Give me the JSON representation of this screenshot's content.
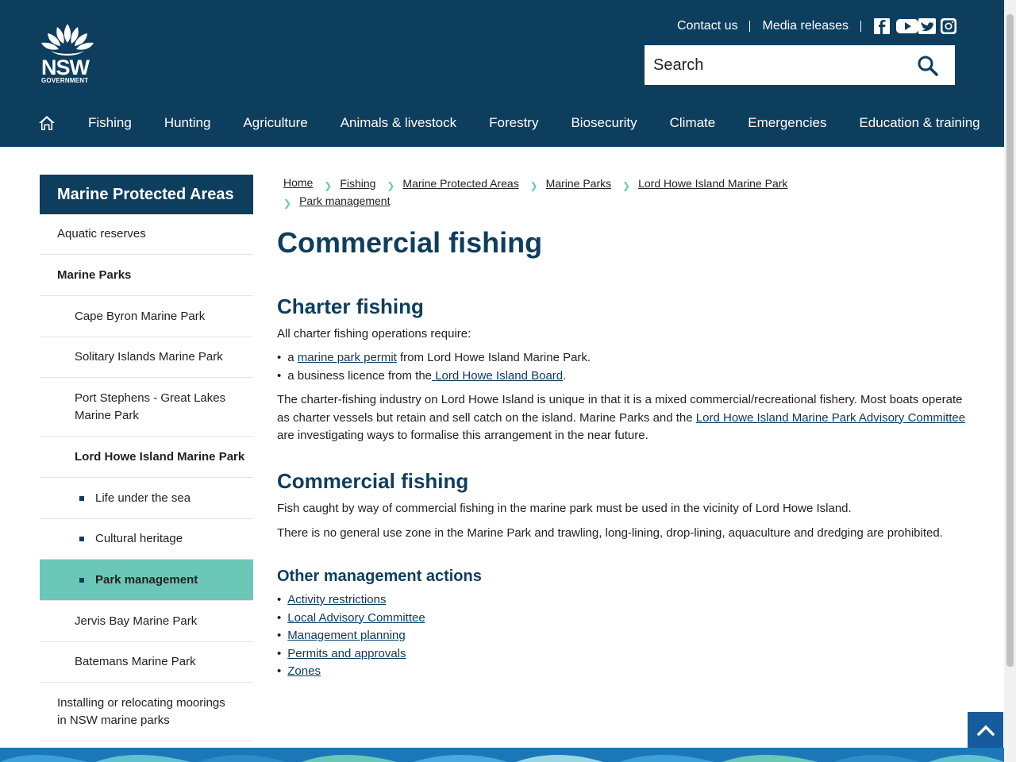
{
  "header": {
    "logo_text": "NSW",
    "logo_sub": "GOVERNMENT",
    "util_links": [
      "Contact us",
      "Media releases"
    ],
    "social_icons": [
      "facebook-icon",
      "youtube-icon",
      "twitter-icon",
      "instagram-icon"
    ],
    "search_placeholder": "Search",
    "nav": [
      "Fishing",
      "Hunting",
      "Agriculture",
      "Animals & livestock",
      "Forestry",
      "Biosecurity",
      "Climate",
      "Emergencies",
      "Education & training"
    ]
  },
  "sidebar": {
    "title": "Marine Protected Areas",
    "items": [
      {
        "label": "Aquatic reserves"
      },
      {
        "label": "Marine Parks"
      },
      {
        "label": "Cape Byron Marine Park"
      },
      {
        "label": "Solitary Islands Marine Park"
      },
      {
        "label": "Port Stephens - Great Lakes Marine Park"
      },
      {
        "label": "Lord Howe Island Marine Park"
      },
      {
        "label": "Life under the sea"
      },
      {
        "label": "Cultural heritage"
      },
      {
        "label": "Park management"
      },
      {
        "label": "Jervis Bay Marine Park"
      },
      {
        "label": "Batemans Marine Park"
      },
      {
        "label": "Installing or relocating moorings in NSW marine parks"
      }
    ]
  },
  "breadcrumb": [
    "Home",
    "Fishing",
    "Marine Protected Areas",
    "Marine Parks",
    "Lord Howe Island Marine Park",
    "Park management"
  ],
  "page": {
    "title": "Commercial fishing",
    "charter": {
      "heading": "Charter fishing",
      "intro": "All charter fishing operations require:",
      "item1_pre": "a ",
      "item1_link": "marine park permit",
      "item1_post": " from Lord Howe Island Marine Park.",
      "item2_pre": "a business licence from the",
      "item2_link": " Lord Howe Island Board",
      "item2_post": ".",
      "para_pre": "The charter-fishing industry on Lord Howe Island is unique in that it is a mixed commercial/recreational fishery.  Most boats operate as charter vessels but retain and sell catch on the island. Marine Parks and the ",
      "para_link": "Lord Howe Island Marine Park Advisory Committee",
      "para_post": " are investigating ways to formalise this arrangement in the near future."
    },
    "commercial": {
      "heading": "Commercial fishing",
      "p1": "Fish caught by way of commercial fishing in the marine park must be used in the vicinity of Lord Howe Island.",
      "p2": "There is no general use zone in the Marine Park and trawling, long-lining, drop-lining, aquaculture and dredging are prohibited."
    },
    "other": {
      "heading": "Other management actions",
      "links": [
        "Activity restrictions",
        "Local Advisory Committee",
        "Management planning",
        "Permits and approvals",
        "Zones"
      ]
    }
  },
  "colors": {
    "header_bg": "#0e3e5e",
    "accent_teal": "#6bc8b8",
    "back_to_top": "#165b9c"
  }
}
